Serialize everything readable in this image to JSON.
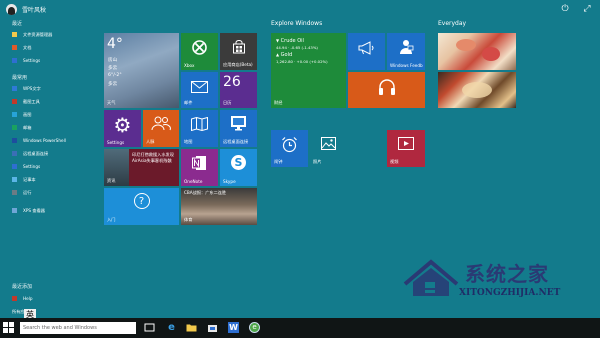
{
  "user": {
    "name": "雪叶风秋"
  },
  "left": {
    "sections": [
      {
        "title": "最近",
        "items": [
          {
            "label": "文件资源管理器",
            "color": "#f2c94c"
          },
          {
            "label": "文档",
            "color": "#e05a2b"
          },
          {
            "label": "Settings",
            "color": "#2e6fd1"
          }
        ]
      },
      {
        "title": "最常用",
        "items": [
          {
            "label": "WPS文字",
            "color": "#2e7ad6"
          },
          {
            "label": "截图工具",
            "color": "#c0392b"
          },
          {
            "label": "画图",
            "color": "#27a3d8"
          },
          {
            "label": "邮箱",
            "color": "#1aa260"
          },
          {
            "label": "Windows PowerShell",
            "color": "#1d4e9e"
          },
          {
            "label": "远程桌面连接",
            "color": "#3b6fb6"
          },
          {
            "label": "Settings",
            "color": "#2e6fd1"
          },
          {
            "label": "记事本",
            "color": "#5bb5e6"
          },
          {
            "label": "运行",
            "color": "#6b7c85"
          },
          {
            "label": "XPS 查看器",
            "color": "#6fa6d6"
          }
        ]
      },
      {
        "title": "最近添加",
        "items": [
          {
            "label": "Help",
            "color": "#c0392b"
          }
        ]
      }
    ],
    "all_apps": "所有应用"
  },
  "groups": {
    "explore": "Explore Windows",
    "everyday": "Everyday"
  },
  "tiles": {
    "weather": {
      "temp": "4°",
      "city": "房山",
      "cond": "多云",
      "range": "6°/-2°",
      "wind": "多云",
      "label": "天气"
    },
    "xbox": {
      "label": "Xbox"
    },
    "store": {
      "label": "应用商店(Beta)"
    },
    "mail": {
      "label": "邮件"
    },
    "calendar": {
      "day": "26",
      "label": "日历"
    },
    "settings": {
      "label": "Settings"
    },
    "people": {
      "label": "人脉"
    },
    "maps": {
      "label": "地图"
    },
    "rdp": {
      "label": "远程桌面连接"
    },
    "news": {
      "headline": "印尼打捞救援入水发现AirAsia失事客机残骸",
      "label": "资讯"
    },
    "onenote": {
      "label": "OneNote"
    },
    "skype": {
      "label": "Skype"
    },
    "help": {
      "label": "入门"
    },
    "sports": {
      "headline": "CBA战报：广东二连胜",
      "label": "体育"
    },
    "finance": {
      "line1_name": "Crude Oil",
      "line1_value": "44.94 · -0.65 (-1.43%)",
      "line2_name": "Gold",
      "line2_value": "1,262.80 · +0.00 (+0.02%)",
      "label": "财经"
    },
    "feedback": {
      "label": "Windows Feedb"
    },
    "xbox_music": {
      "label": ""
    },
    "alarms": {
      "label": "闹钟"
    },
    "photos": {
      "label": "照片"
    },
    "video": {
      "label": "视频"
    },
    "announce": {
      "label": ""
    }
  },
  "taskbar": {
    "search_placeholder": "Search the web and Windows"
  },
  "ime": "英",
  "watermark": {
    "cn": "系统之家",
    "en": "XITONGZHIJIA.NET"
  },
  "colors": {
    "background": "#137b8c",
    "tile_green": "#1e8b3a",
    "tile_blue": "#1d6fc7",
    "tile_purple": "#5b2d90",
    "tile_orange": "#d85a19",
    "tile_red": "#c0392b",
    "tile_crimson": "#b0283f",
    "tile_dark": "#2b2b2b"
  }
}
